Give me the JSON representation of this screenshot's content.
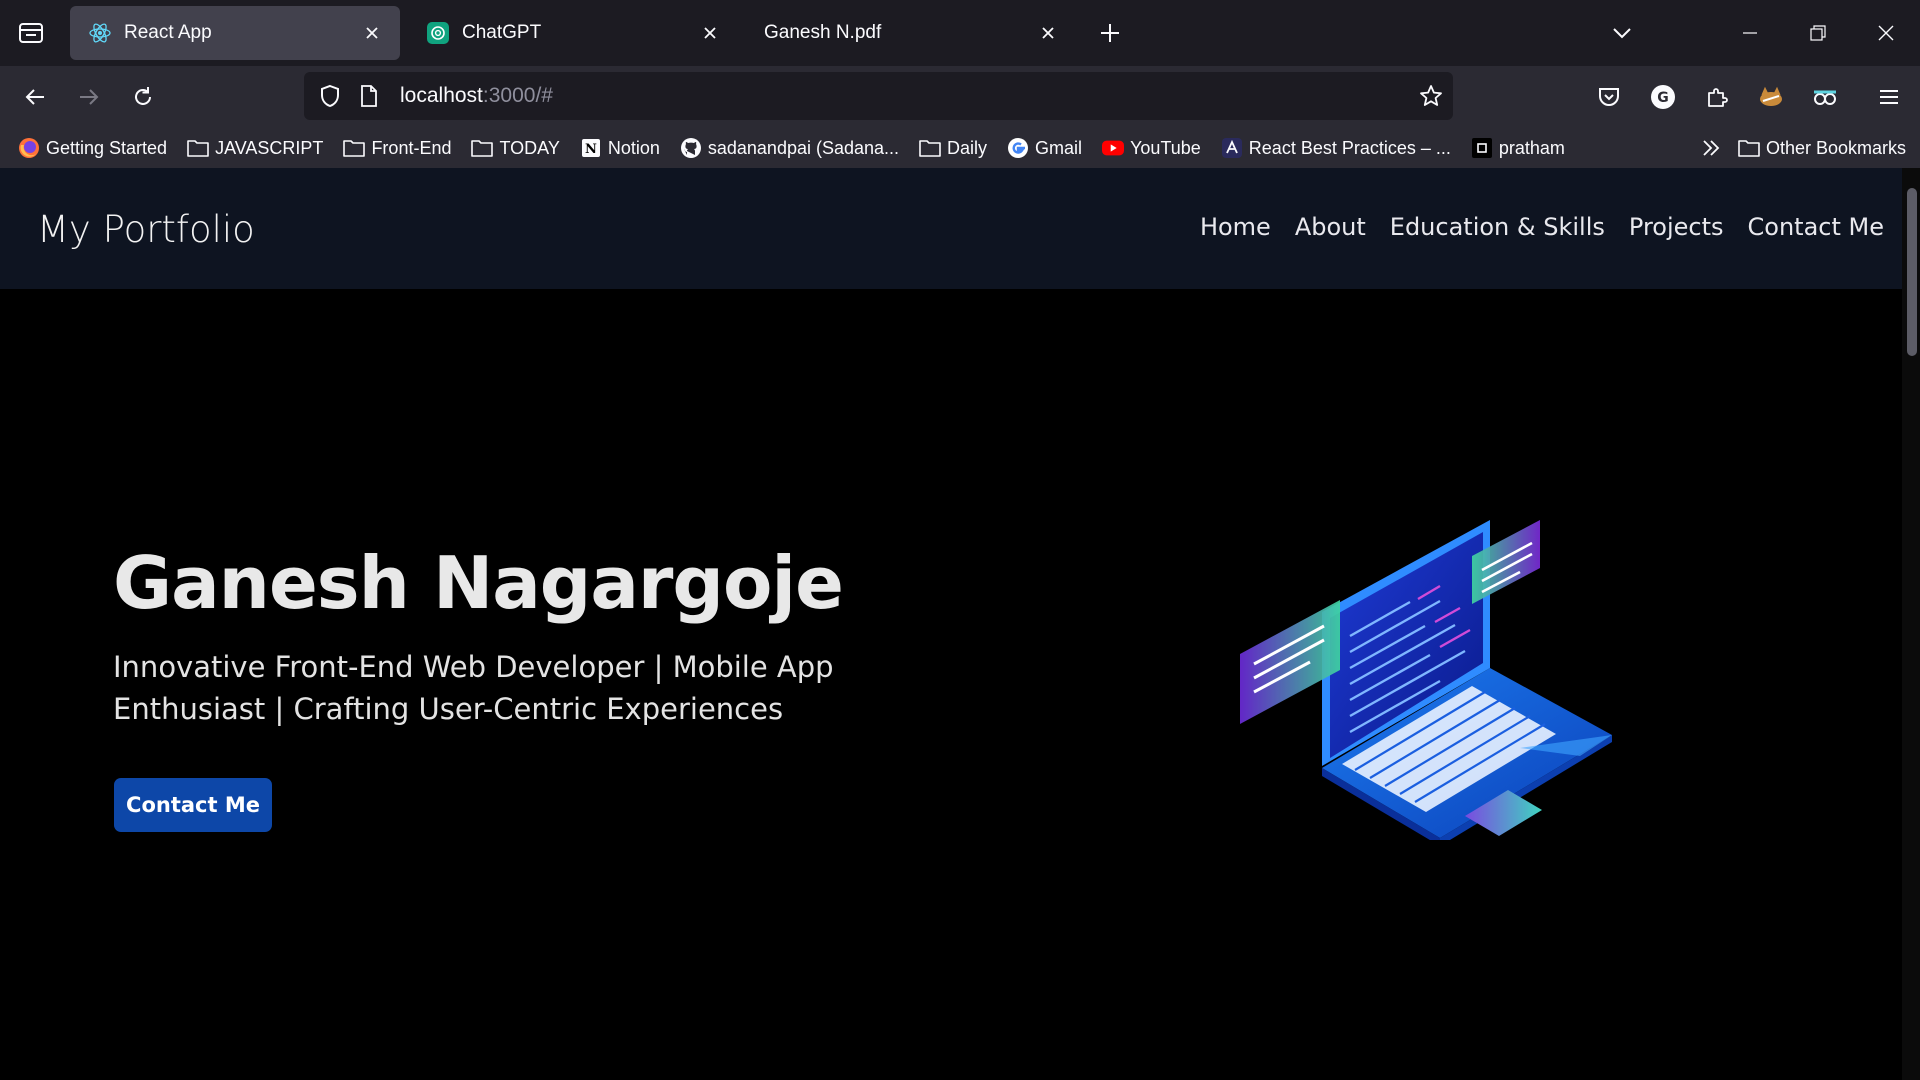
{
  "browser": {
    "tabs": [
      {
        "title": "React App",
        "active": true
      },
      {
        "title": "ChatGPT",
        "active": false
      },
      {
        "title": "Ganesh N.pdf",
        "active": false
      }
    ],
    "url_host": "localhost",
    "url_rest": ":3000/#",
    "bookmarks": [
      {
        "label": "Getting Started",
        "icon": "firefox-icon"
      },
      {
        "label": "JAVASCRIPT",
        "icon": "folder-icon"
      },
      {
        "label": "Front-End",
        "icon": "folder-icon"
      },
      {
        "label": "TODAY",
        "icon": "folder-icon"
      },
      {
        "label": "Notion",
        "icon": "notion-icon"
      },
      {
        "label": "sadanandpai (Sadana...",
        "icon": "github-icon"
      },
      {
        "label": "Daily",
        "icon": "folder-icon"
      },
      {
        "label": "Gmail",
        "icon": "google-icon"
      },
      {
        "label": "YouTube",
        "icon": "youtube-icon"
      },
      {
        "label": "React Best Practices – ...",
        "icon": "site-icon"
      },
      {
        "label": "pratham",
        "icon": "site-icon"
      }
    ],
    "other_bookmarks": "Other Bookmarks"
  },
  "site": {
    "brand": "My Portfolio",
    "nav": [
      "Home",
      "About",
      "Education & Skills",
      "Projects",
      "Contact Me"
    ],
    "hero": {
      "name": "Ganesh Nagargoje",
      "tagline": "Innovative Front-End Web Developer | Mobile App Enthusiast | Crafting User-Centric Experiences",
      "cta": "Contact Me"
    },
    "colors": {
      "nav_bg": "#0e1421",
      "page_bg": "#000000",
      "cta_bg": "#0d47a8"
    }
  }
}
